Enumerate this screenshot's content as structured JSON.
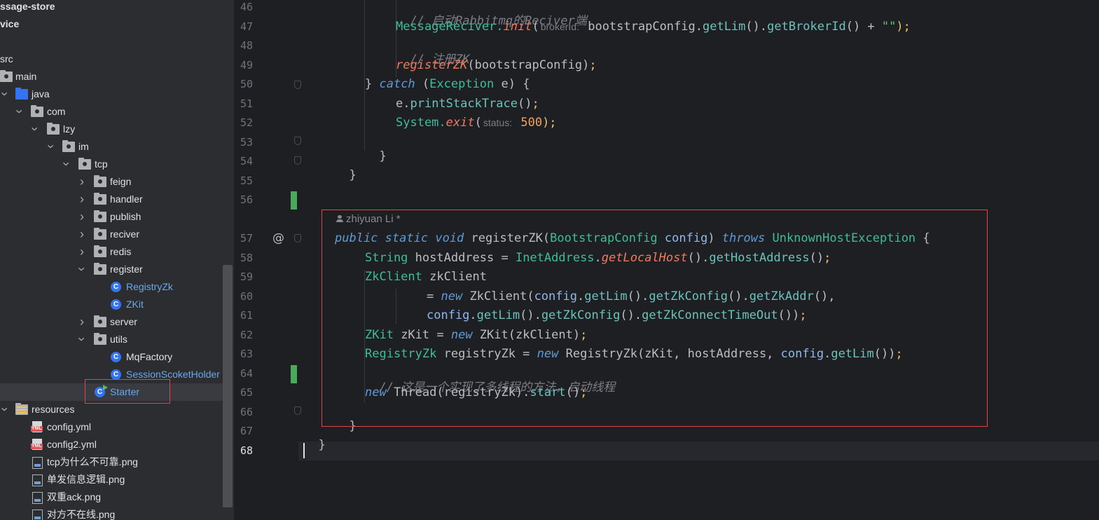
{
  "project_tree": {
    "rows": [
      {
        "label": "ssage-store",
        "kind": "module",
        "bold": true
      },
      {
        "label": "vice",
        "kind": "module",
        "bold": true
      },
      {
        "label": "src",
        "kind": "src"
      },
      {
        "label": "main",
        "kind": "folder",
        "open": true
      },
      {
        "label": "java",
        "kind": "java-folder",
        "open": true
      },
      {
        "label": "com",
        "kind": "package",
        "open": true
      },
      {
        "label": "lzy",
        "kind": "package",
        "open": true
      },
      {
        "label": "im",
        "kind": "package",
        "open": true
      },
      {
        "label": "tcp",
        "kind": "package",
        "open": true
      },
      {
        "label": "feign",
        "kind": "package",
        "open": false
      },
      {
        "label": "handler",
        "kind": "package",
        "open": false
      },
      {
        "label": "publish",
        "kind": "package",
        "open": false
      },
      {
        "label": "reciver",
        "kind": "package",
        "open": false
      },
      {
        "label": "redis",
        "kind": "package",
        "open": false
      },
      {
        "label": "register",
        "kind": "package",
        "open": true
      },
      {
        "label": "RegistryZk",
        "kind": "class"
      },
      {
        "label": "ZKit",
        "kind": "class"
      },
      {
        "label": "server",
        "kind": "package",
        "open": false
      },
      {
        "label": "utils",
        "kind": "package",
        "open": true
      },
      {
        "label": "MqFactory",
        "kind": "class"
      },
      {
        "label": "SessionScoketHolder",
        "kind": "class"
      },
      {
        "label": "Starter",
        "kind": "main-class",
        "selected": true
      },
      {
        "label": "resources",
        "kind": "resources",
        "open": true
      },
      {
        "label": "config.yml",
        "kind": "yml"
      },
      {
        "label": "config2.yml",
        "kind": "yml"
      },
      {
        "label": "tcp为什么不可靠.png",
        "kind": "image"
      },
      {
        "label": "单发信息逻辑.png",
        "kind": "image"
      },
      {
        "label": "双重ack.png",
        "kind": "image"
      },
      {
        "label": "对方不在线.png",
        "kind": "image"
      }
    ]
  },
  "editor": {
    "author_hint": "zhiyuan Li *",
    "line_numbers": [
      "46",
      "47",
      "48",
      "49",
      "50",
      "51",
      "52",
      "53",
      "54",
      "55",
      "56",
      "57",
      "58",
      "59",
      "60",
      "61",
      "62",
      "63",
      "64",
      "65",
      "66",
      "67",
      "68"
    ],
    "code": {
      "l46": "// 启动Rabbitmq的Reciver端",
      "l47_a": "MessageReciver.",
      "l47_b": "init",
      "l47_c": "(",
      "l47_hint": "brokerId:",
      "l47_d": " bootstrapConfig.",
      "l47_e": "getLim",
      "l47_f": "().",
      "l47_g": "getBrokerId",
      "l47_h": "() + ",
      "l47_i": "\"\"",
      "l47_j": ");",
      "l48": "// 注册ZK",
      "l49_a": "registerZK",
      "l49_b": "(bootstrapConfig)",
      "l49_c": ";",
      "l50_a": "} ",
      "l50_b": "catch",
      "l50_c": " (",
      "l50_d": "Exception",
      "l50_e": " e) {",
      "l51_a": "e.",
      "l51_b": "printStackTrace",
      "l51_c": "()",
      "l51_d": ";",
      "l52_a": "System.",
      "l52_b": "exit",
      "l52_c": "(",
      "l52_hint": "status:",
      "l52_d": " 500",
      "l52_e": ");",
      "l53": "}",
      "l54": "}",
      "l57_a": "public",
      "l57_b": " ",
      "l57_c": "static",
      "l57_d": " ",
      "l57_e": "void",
      "l57_f": " registerZK(",
      "l57_g": "BootstrapConfig",
      "l57_h": " config",
      "l57_i": ") ",
      "l57_j": "throws",
      "l57_k": " ",
      "l57_l": "UnknownHostException",
      "l57_m": " {",
      "l58_a": "String",
      "l58_b": " hostAddress = ",
      "l58_c": "InetAddress",
      "l58_d": ".",
      "l58_e": "getLocalHost",
      "l58_f": "().",
      "l58_g": "getHostAddress",
      "l58_h": "()",
      "l58_i": ";",
      "l59_a": "ZkClient",
      "l59_b": " zkClient",
      "l60_a": "= ",
      "l60_b": "new",
      "l60_c": " ZkClient(",
      "l60_d": "config",
      "l60_e": ".",
      "l60_f": "getLim",
      "l60_g": "().",
      "l60_h": "getZkConfig",
      "l60_i": "().",
      "l60_j": "getZkAddr",
      "l60_k": "(),",
      "l61_a": "config",
      "l61_b": ".",
      "l61_c": "getLim",
      "l61_d": "().",
      "l61_e": "getZkConfig",
      "l61_f": "().",
      "l61_g": "getZkConnectTimeOut",
      "l61_h": "())",
      "l61_i": ";",
      "l62_a": "ZKit",
      "l62_b": " zKit = ",
      "l62_c": "new",
      "l62_d": " ZKit(zkClient)",
      "l62_e": ";",
      "l63_a": "RegistryZk",
      "l63_b": " registryZk = ",
      "l63_c": "new",
      "l63_d": " RegistryZk(zKit, hostAddress, ",
      "l63_e": "config",
      "l63_f": ".",
      "l63_g": "getLim",
      "l63_h": "())",
      "l63_i": ";",
      "l64": "// 这是一个实现了多线程的方法，启动线程",
      "l65_a": "new",
      "l65_b": " Thread(registryZk).",
      "l65_c": "start",
      "l65_d": "()",
      "l65_e": ";",
      "l66": "}",
      "l67": "}"
    },
    "gutter_marker": "@"
  },
  "colors": {
    "accent": "#3574f0",
    "highlight_box": "#e04646",
    "change_marker": "#4aa95b"
  }
}
